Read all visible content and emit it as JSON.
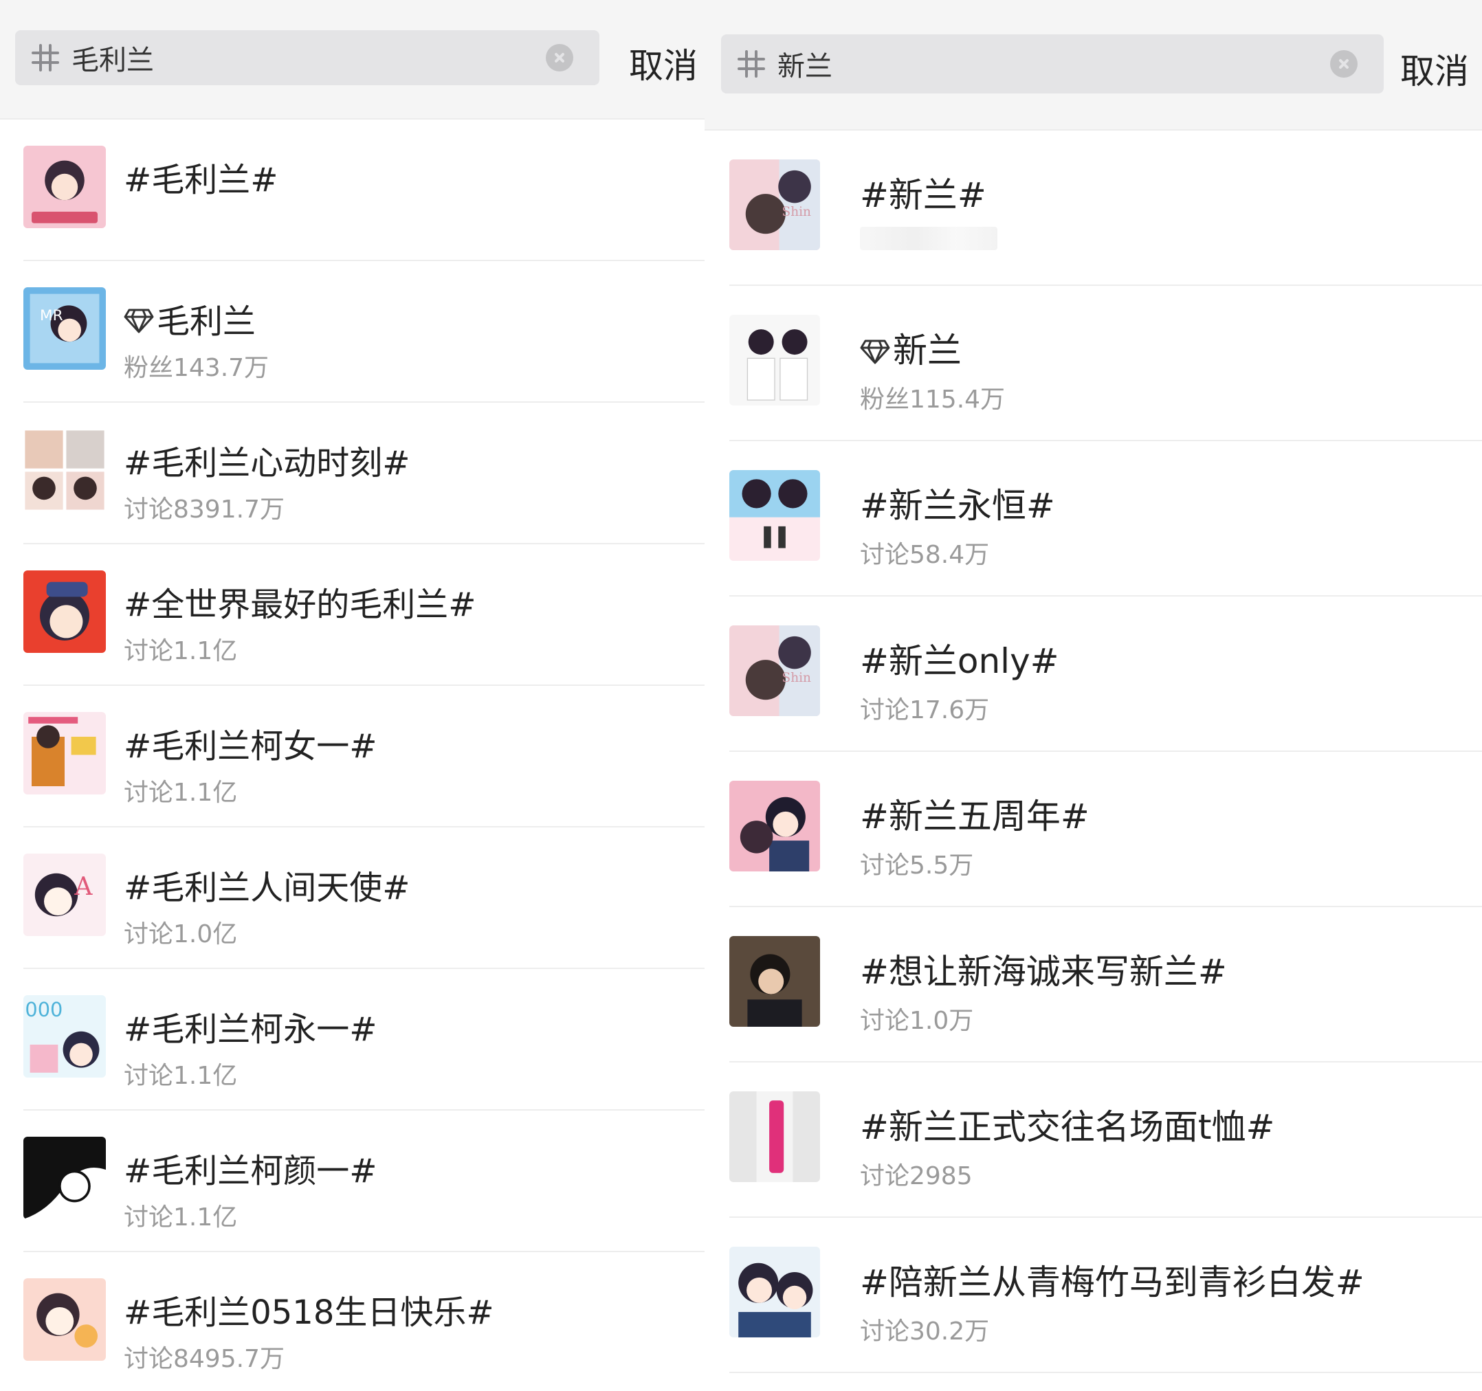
{
  "left": {
    "search": {
      "query": "毛利兰",
      "cancel_label": "取消"
    },
    "results": [
      {
        "title": "#毛利兰#",
        "sub": "",
        "verified": false,
        "thumb": "pink"
      },
      {
        "title": "毛利兰",
        "sub": "粉丝143.7万",
        "verified": true,
        "thumb": "blue"
      },
      {
        "title": "#毛利兰心动时刻#",
        "sub": "讨论8391.7万",
        "verified": false,
        "thumb": "grid"
      },
      {
        "title": "#全世界最好的毛利兰#",
        "sub": "讨论1.1亿",
        "verified": false,
        "thumb": "red"
      },
      {
        "title": "#毛利兰柯女一#",
        "sub": "讨论1.1亿",
        "verified": false,
        "thumb": "poster"
      },
      {
        "title": "#毛利兰人间天使#",
        "sub": "讨论1.0亿",
        "verified": false,
        "thumb": "light"
      },
      {
        "title": "#毛利兰柯永一#",
        "sub": "讨论1.1亿",
        "verified": false,
        "thumb": "aqua"
      },
      {
        "title": "#毛利兰柯颜一#",
        "sub": "讨论1.1亿",
        "verified": false,
        "thumb": "bw"
      },
      {
        "title": "#毛利兰0518生日快乐#",
        "sub": "讨论8495.7万",
        "verified": false,
        "thumb": "peach"
      }
    ]
  },
  "right": {
    "search": {
      "query": "新兰",
      "cancel_label": "取消"
    },
    "results": [
      {
        "title": "#新兰#",
        "sub": "",
        "verified": false,
        "thumb": "pinkblue"
      },
      {
        "title": "新兰",
        "sub": "粉丝115.4万",
        "verified": true,
        "thumb": "white"
      },
      {
        "title": "#新兰永恒#",
        "sub": "讨论58.4万",
        "verified": false,
        "thumb": "split"
      },
      {
        "title": "#新兰only#",
        "sub": "讨论17.6万",
        "verified": false,
        "thumb": "pinkblue"
      },
      {
        "title": "#新兰五周年#",
        "sub": "讨论5.5万",
        "verified": false,
        "thumb": "rose"
      },
      {
        "title": "#想让新海诚来写新兰#",
        "sub": "讨论1.0万",
        "verified": false,
        "thumb": "dark"
      },
      {
        "title": "#新兰正式交往名场面t恤#",
        "sub": "讨论2985",
        "verified": false,
        "thumb": "gray"
      },
      {
        "title": "#陪新兰从青梅竹马到青衫白发#",
        "sub": "讨论30.2万",
        "verified": false,
        "thumb": "duo"
      }
    ]
  }
}
